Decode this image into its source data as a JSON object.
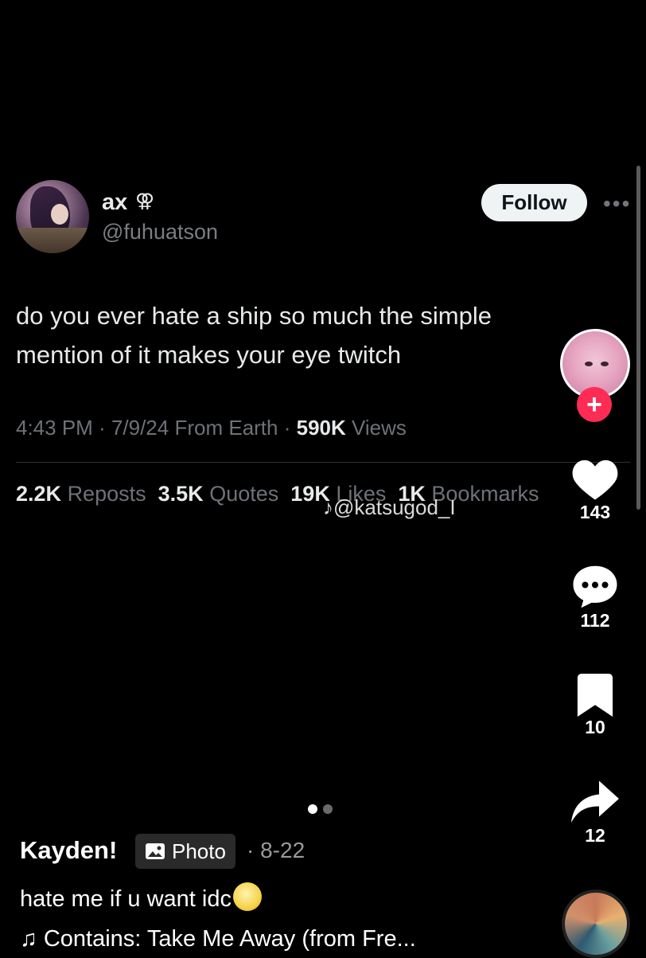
{
  "tweet": {
    "display_name": "ax",
    "name_symbol": "⚢",
    "handle": "@fuhuatson",
    "follow_label": "Follow",
    "more_label": "•••",
    "text_line1": "do you ever hate a ship so much the simple",
    "text_line2": "mention of it makes your eye twitch",
    "time": "4:43 PM",
    "date": "7/9/24",
    "location": "From Earth",
    "views_count": "590K",
    "views_label": "Views",
    "reposts_count": "2.2K",
    "reposts_label": "Reposts",
    "quotes_count": "3.5K",
    "quotes_label": "Quotes",
    "likes_count": "19K",
    "likes_label": "Likes",
    "bookmarks_count": "1K",
    "bookmarks_label": "Bookmarks"
  },
  "watermark": {
    "icon": "tiktok-icon",
    "handle": "@katsugod_I"
  },
  "rail": {
    "follow_plus": "+",
    "likes": "143",
    "comments": "112",
    "saves": "10",
    "shares": "12"
  },
  "carousel": {
    "total": 2,
    "active_index": 0
  },
  "caption": {
    "author": "Kayden!",
    "badge_label": "Photo",
    "date": "· 8-22",
    "text": "hate me if u want idc",
    "music_note": "♫",
    "music": "Contains: Take Me Away (from Fre..."
  },
  "colors": {
    "accent_red": "#fe2c55",
    "muted_gray": "#6e7277"
  }
}
